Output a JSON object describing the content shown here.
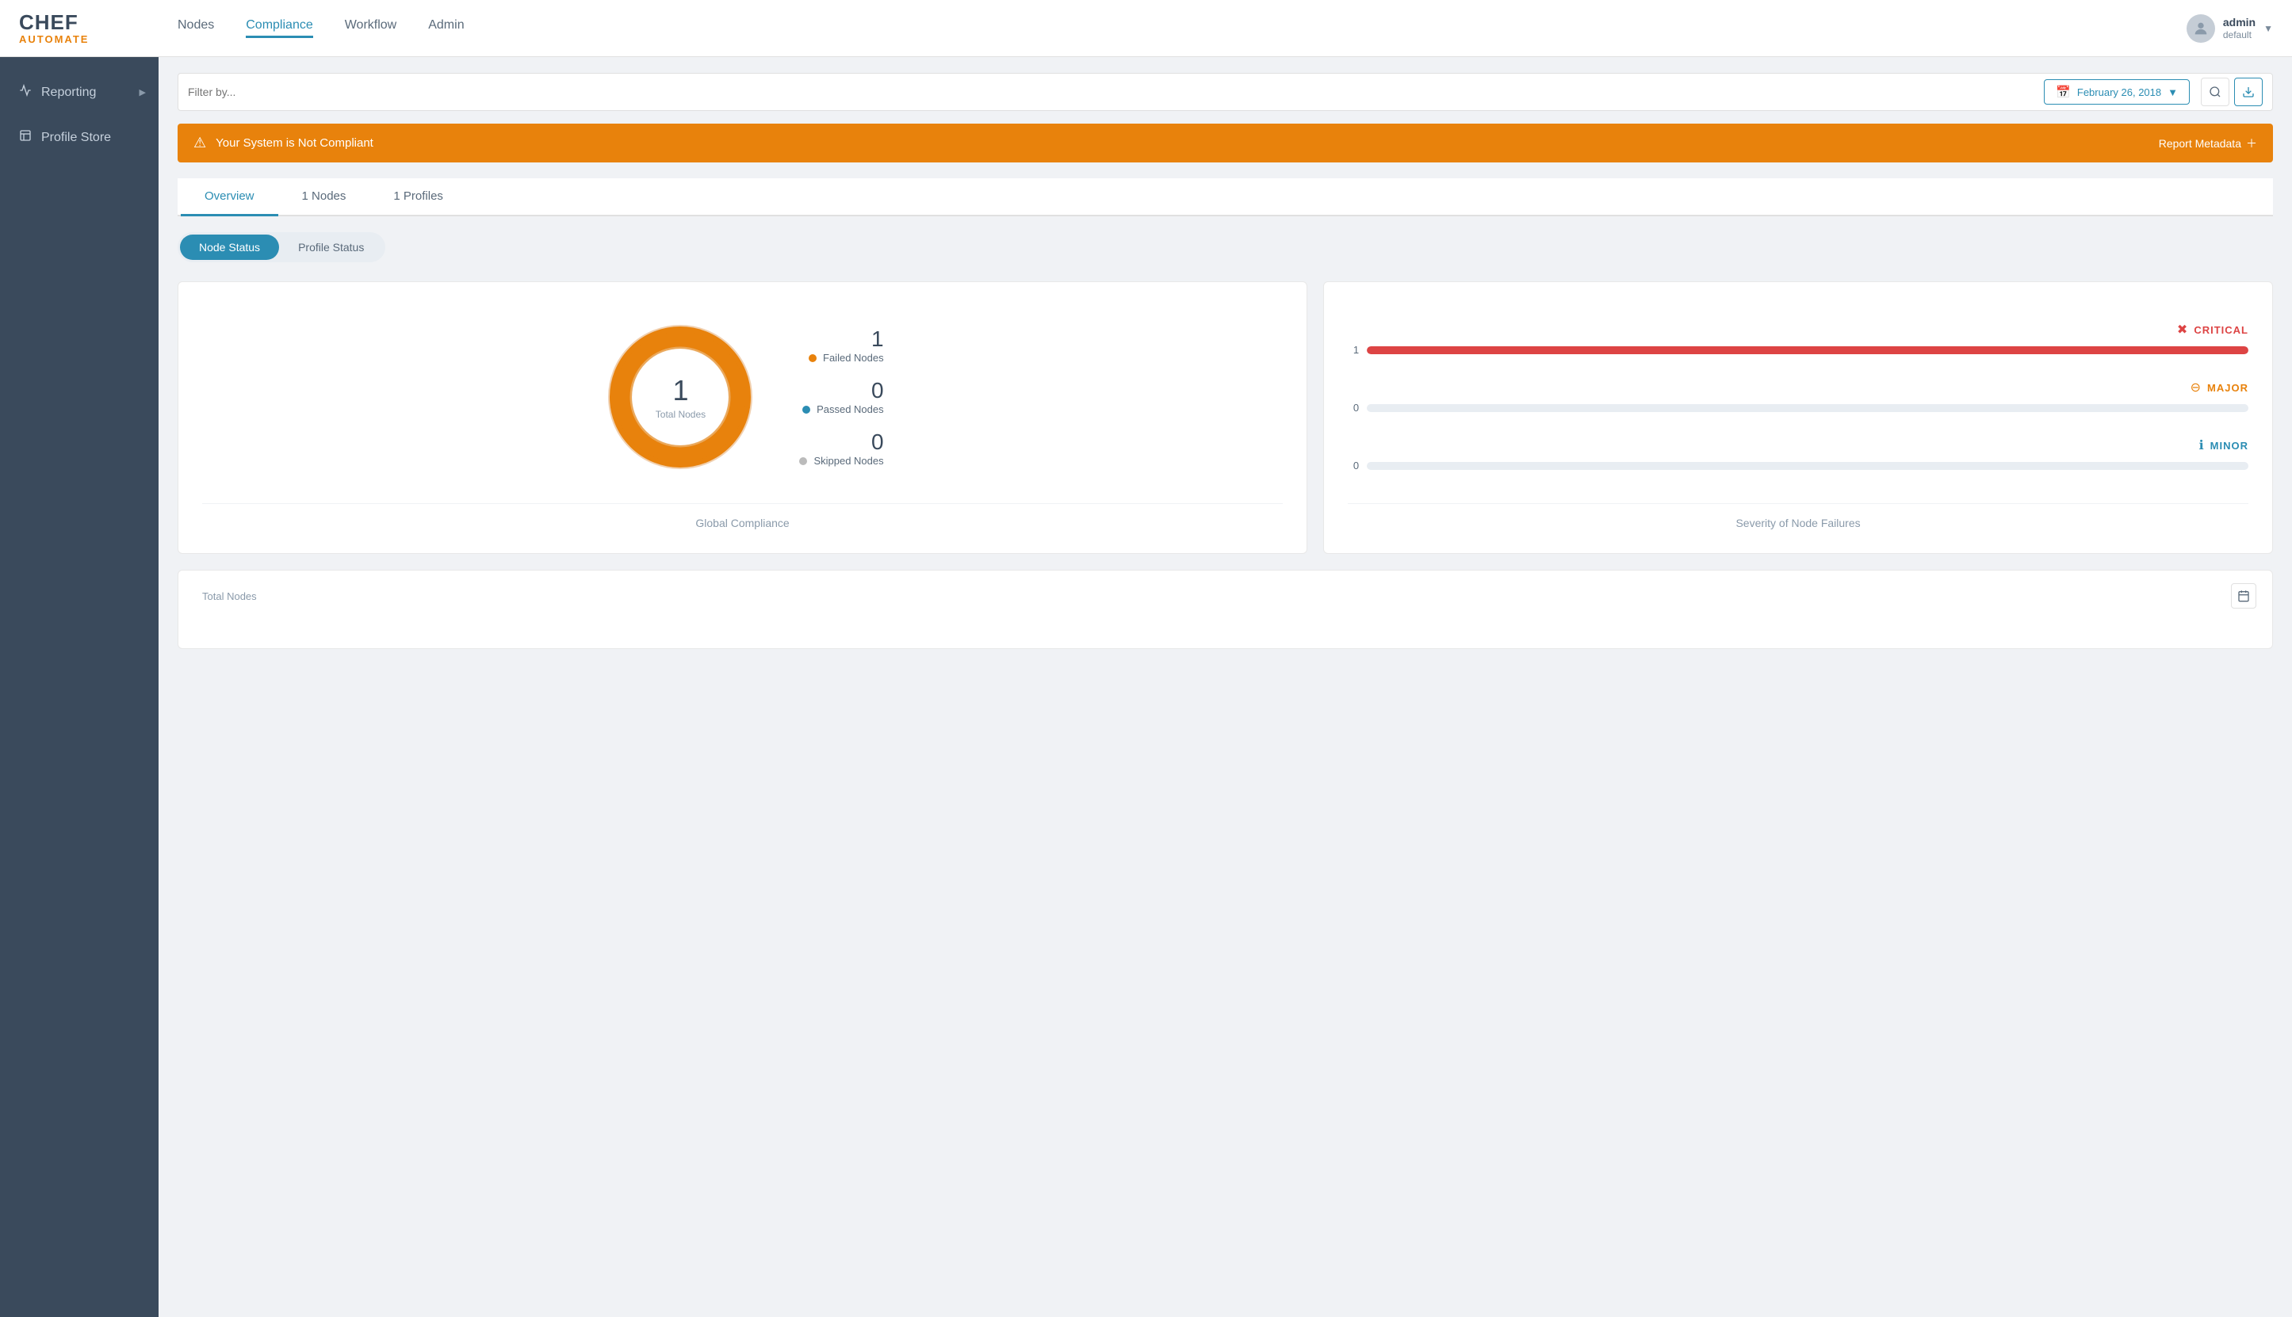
{
  "app": {
    "name": "CHEF",
    "sub": "AUTOMATE"
  },
  "nav": {
    "links": [
      {
        "label": "Nodes",
        "active": false
      },
      {
        "label": "Compliance",
        "active": true
      },
      {
        "label": "Workflow",
        "active": false
      },
      {
        "label": "Admin",
        "active": false
      }
    ]
  },
  "user": {
    "name": "admin",
    "role": "default",
    "avatar_icon": "👤"
  },
  "sidebar": {
    "items": [
      {
        "label": "Reporting",
        "icon": "📈",
        "arrow": true
      },
      {
        "label": "Profile Store",
        "icon": "📄",
        "arrow": false
      }
    ]
  },
  "filter": {
    "placeholder": "Filter by...",
    "date": "February 26, 2018"
  },
  "alert": {
    "message": "Your System is Not Compliant",
    "action": "Report Metadata"
  },
  "tabs": [
    {
      "label": "Overview",
      "active": true
    },
    {
      "label": "1 Nodes",
      "active": false
    },
    {
      "label": "1 Profiles",
      "active": false
    }
  ],
  "toggles": [
    {
      "label": "Node Status",
      "active": true
    },
    {
      "label": "Profile Status",
      "active": false
    }
  ],
  "global_compliance": {
    "total_nodes": "1",
    "total_label": "Total Nodes",
    "failed": {
      "count": "1",
      "label": "Failed Nodes"
    },
    "passed": {
      "count": "0",
      "label": "Passed Nodes"
    },
    "skipped": {
      "count": "0",
      "label": "Skipped Nodes"
    },
    "title": "Global Compliance"
  },
  "severity": {
    "title": "Severity of Node Failures",
    "items": [
      {
        "label": "CRITICAL",
        "count": "1",
        "fill_pct": 100,
        "type": "critical"
      },
      {
        "label": "MAJOR",
        "count": "0",
        "fill_pct": 0,
        "type": "major"
      },
      {
        "label": "MINOR",
        "count": "0",
        "fill_pct": 0,
        "type": "minor"
      }
    ]
  },
  "bottom_card": {
    "title": "Total Nodes"
  }
}
